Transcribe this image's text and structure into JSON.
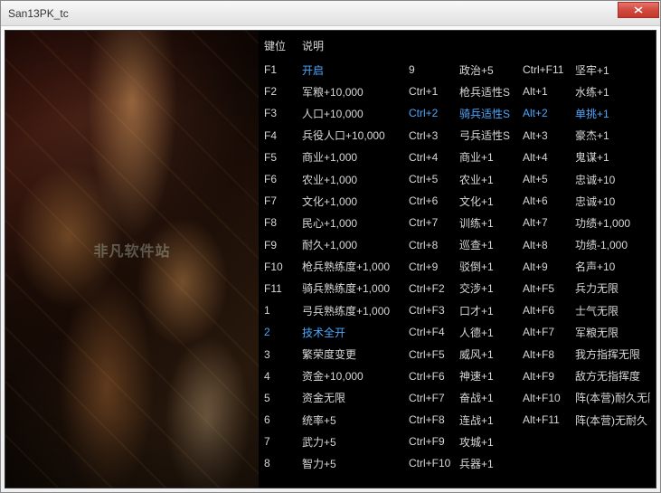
{
  "window": {
    "title": "San13PK_tc"
  },
  "headers": {
    "key": "键位",
    "desc": "说明"
  },
  "watermark": "非凡软件站",
  "rows": [
    {
      "k1": "F1",
      "d1": "开启",
      "k2": "9",
      "d2": "政治+5",
      "k3": "Ctrl+F11",
      "d3": "坚牢+1",
      "a1": true
    },
    {
      "k1": "F2",
      "d1": "军粮+10,000",
      "k2": "Ctrl+1",
      "d2": "枪兵适性S",
      "k3": "Alt+1",
      "d3": "水练+1"
    },
    {
      "k1": "F3",
      "d1": "人口+10,000",
      "k2": "Ctrl+2",
      "d2": "骑兵适性S",
      "k3": "Alt+2",
      "d3": "单挑+1",
      "a2": true,
      "a3": true
    },
    {
      "k1": "F4",
      "d1": "兵役人口+10,000",
      "k2": "Ctrl+3",
      "d2": "弓兵适性S",
      "k3": "Alt+3",
      "d3": "豪杰+1"
    },
    {
      "k1": "F5",
      "d1": "商业+1,000",
      "k2": "Ctrl+4",
      "d2": "商业+1",
      "k3": "Alt+4",
      "d3": "鬼谋+1"
    },
    {
      "k1": "F6",
      "d1": "农业+1,000",
      "k2": "Ctrl+5",
      "d2": "农业+1",
      "k3": "Alt+5",
      "d3": "忠诚+10"
    },
    {
      "k1": "F7",
      "d1": "文化+1,000",
      "k2": "Ctrl+6",
      "d2": "文化+1",
      "k3": "Alt+6",
      "d3": "忠诚+10"
    },
    {
      "k1": "F8",
      "d1": "民心+1,000",
      "k2": "Ctrl+7",
      "d2": "训练+1",
      "k3": "Alt+7",
      "d3": "功绩+1,000"
    },
    {
      "k1": "F9",
      "d1": "耐久+1,000",
      "k2": "Ctrl+8",
      "d2": "巡查+1",
      "k3": "Alt+8",
      "d3": "功绩-1,000"
    },
    {
      "k1": "F10",
      "d1": "枪兵熟练度+1,000",
      "k2": "Ctrl+9",
      "d2": "驳倒+1",
      "k3": "Alt+9",
      "d3": "名声+10"
    },
    {
      "k1": "F11",
      "d1": "骑兵熟练度+1,000",
      "k2": "Ctrl+F2",
      "d2": "交涉+1",
      "k3": "Alt+F5",
      "d3": "兵力无限"
    },
    {
      "k1": "1",
      "d1": "弓兵熟练度+1,000",
      "k2": "Ctrl+F3",
      "d2": "口才+1",
      "k3": "Alt+F6",
      "d3": "士气无限"
    },
    {
      "k1": "2",
      "d1": "技术全开",
      "k2": "Ctrl+F4",
      "d2": "人德+1",
      "k3": "Alt+F7",
      "d3": "军粮无限",
      "a0": true,
      "a1": true
    },
    {
      "k1": "3",
      "d1": "繁荣度变更",
      "k2": "Ctrl+F5",
      "d2": "威风+1",
      "k3": "Alt+F8",
      "d3": "我方指挥无限"
    },
    {
      "k1": "4",
      "d1": "资金+10,000",
      "k2": "Ctrl+F6",
      "d2": "神速+1",
      "k3": "Alt+F9",
      "d3": "敌方无指挥度"
    },
    {
      "k1": "5",
      "d1": "资金无限",
      "k2": "Ctrl+F7",
      "d2": "奋战+1",
      "k3": "Alt+F10",
      "d3": "阵(本营)耐久无限"
    },
    {
      "k1": "6",
      "d1": "   统率+5",
      "k2": "Ctrl+F8",
      "d2": "连战+1",
      "k3": "Alt+F11",
      "d3": "阵(本营)无耐久"
    },
    {
      "k1": "7",
      "d1": "   武力+5",
      "k2": "Ctrl+F9",
      "d2": "攻城+1",
      "k3": "",
      "d3": ""
    },
    {
      "k1": "8",
      "d1": "   智力+5",
      "k2": "Ctrl+F10",
      "d2": "兵器+1",
      "k3": "",
      "d3": ""
    }
  ]
}
